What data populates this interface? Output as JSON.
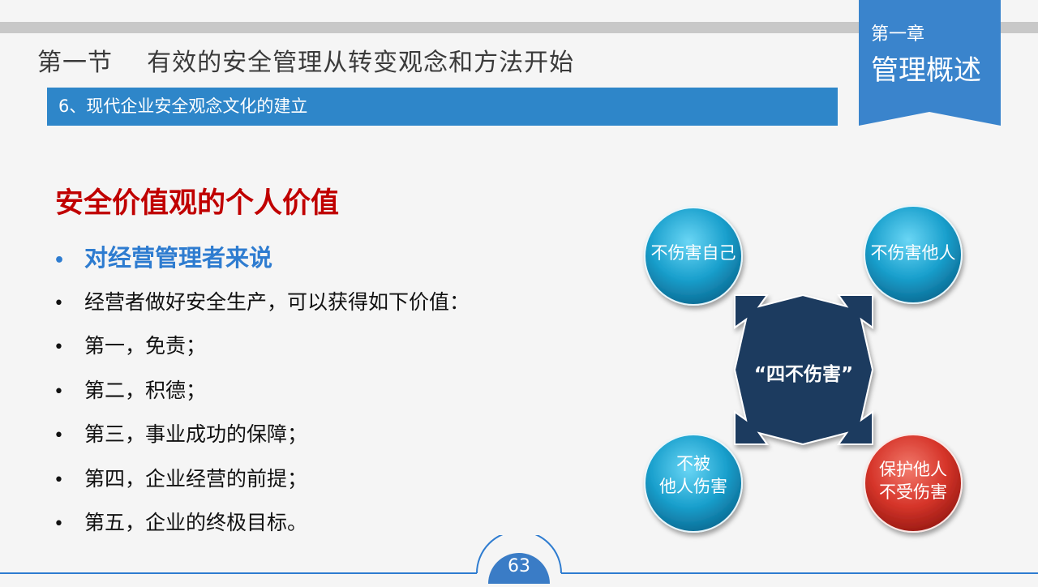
{
  "header": {
    "section_title": "第一节    有效的安全管理从转变观念和方法开始",
    "subtitle": "6、现代企业安全观念文化的建立"
  },
  "chapter": {
    "number": "第一章",
    "name": "管理概述"
  },
  "content": {
    "heading": "安全价值观的个人价值",
    "bullet_symbol": "•",
    "items": [
      "对经营管理者来说",
      "经营者做好安全生产，可以获得如下价值：",
      "第一，免责；",
      "第二，积德；",
      "第三，事业成功的保障；",
      "第四，企业经营的前提；",
      "第五，企业的终极目标。"
    ]
  },
  "diagram": {
    "center": "“四不伤害”",
    "top_left": "不伤害自己",
    "top_right": "不伤害他人",
    "bottom_left": "不被\n他人伤害",
    "bottom_right": "保护他人\n不受伤害"
  },
  "footer": {
    "page_number": "63"
  },
  "colors": {
    "accent_blue": "#2e86c9",
    "heading_red": "#c00000",
    "navy": "#1f3a5f",
    "circle_cyan": "#1fa3cf",
    "circle_red": "#d8322a"
  }
}
